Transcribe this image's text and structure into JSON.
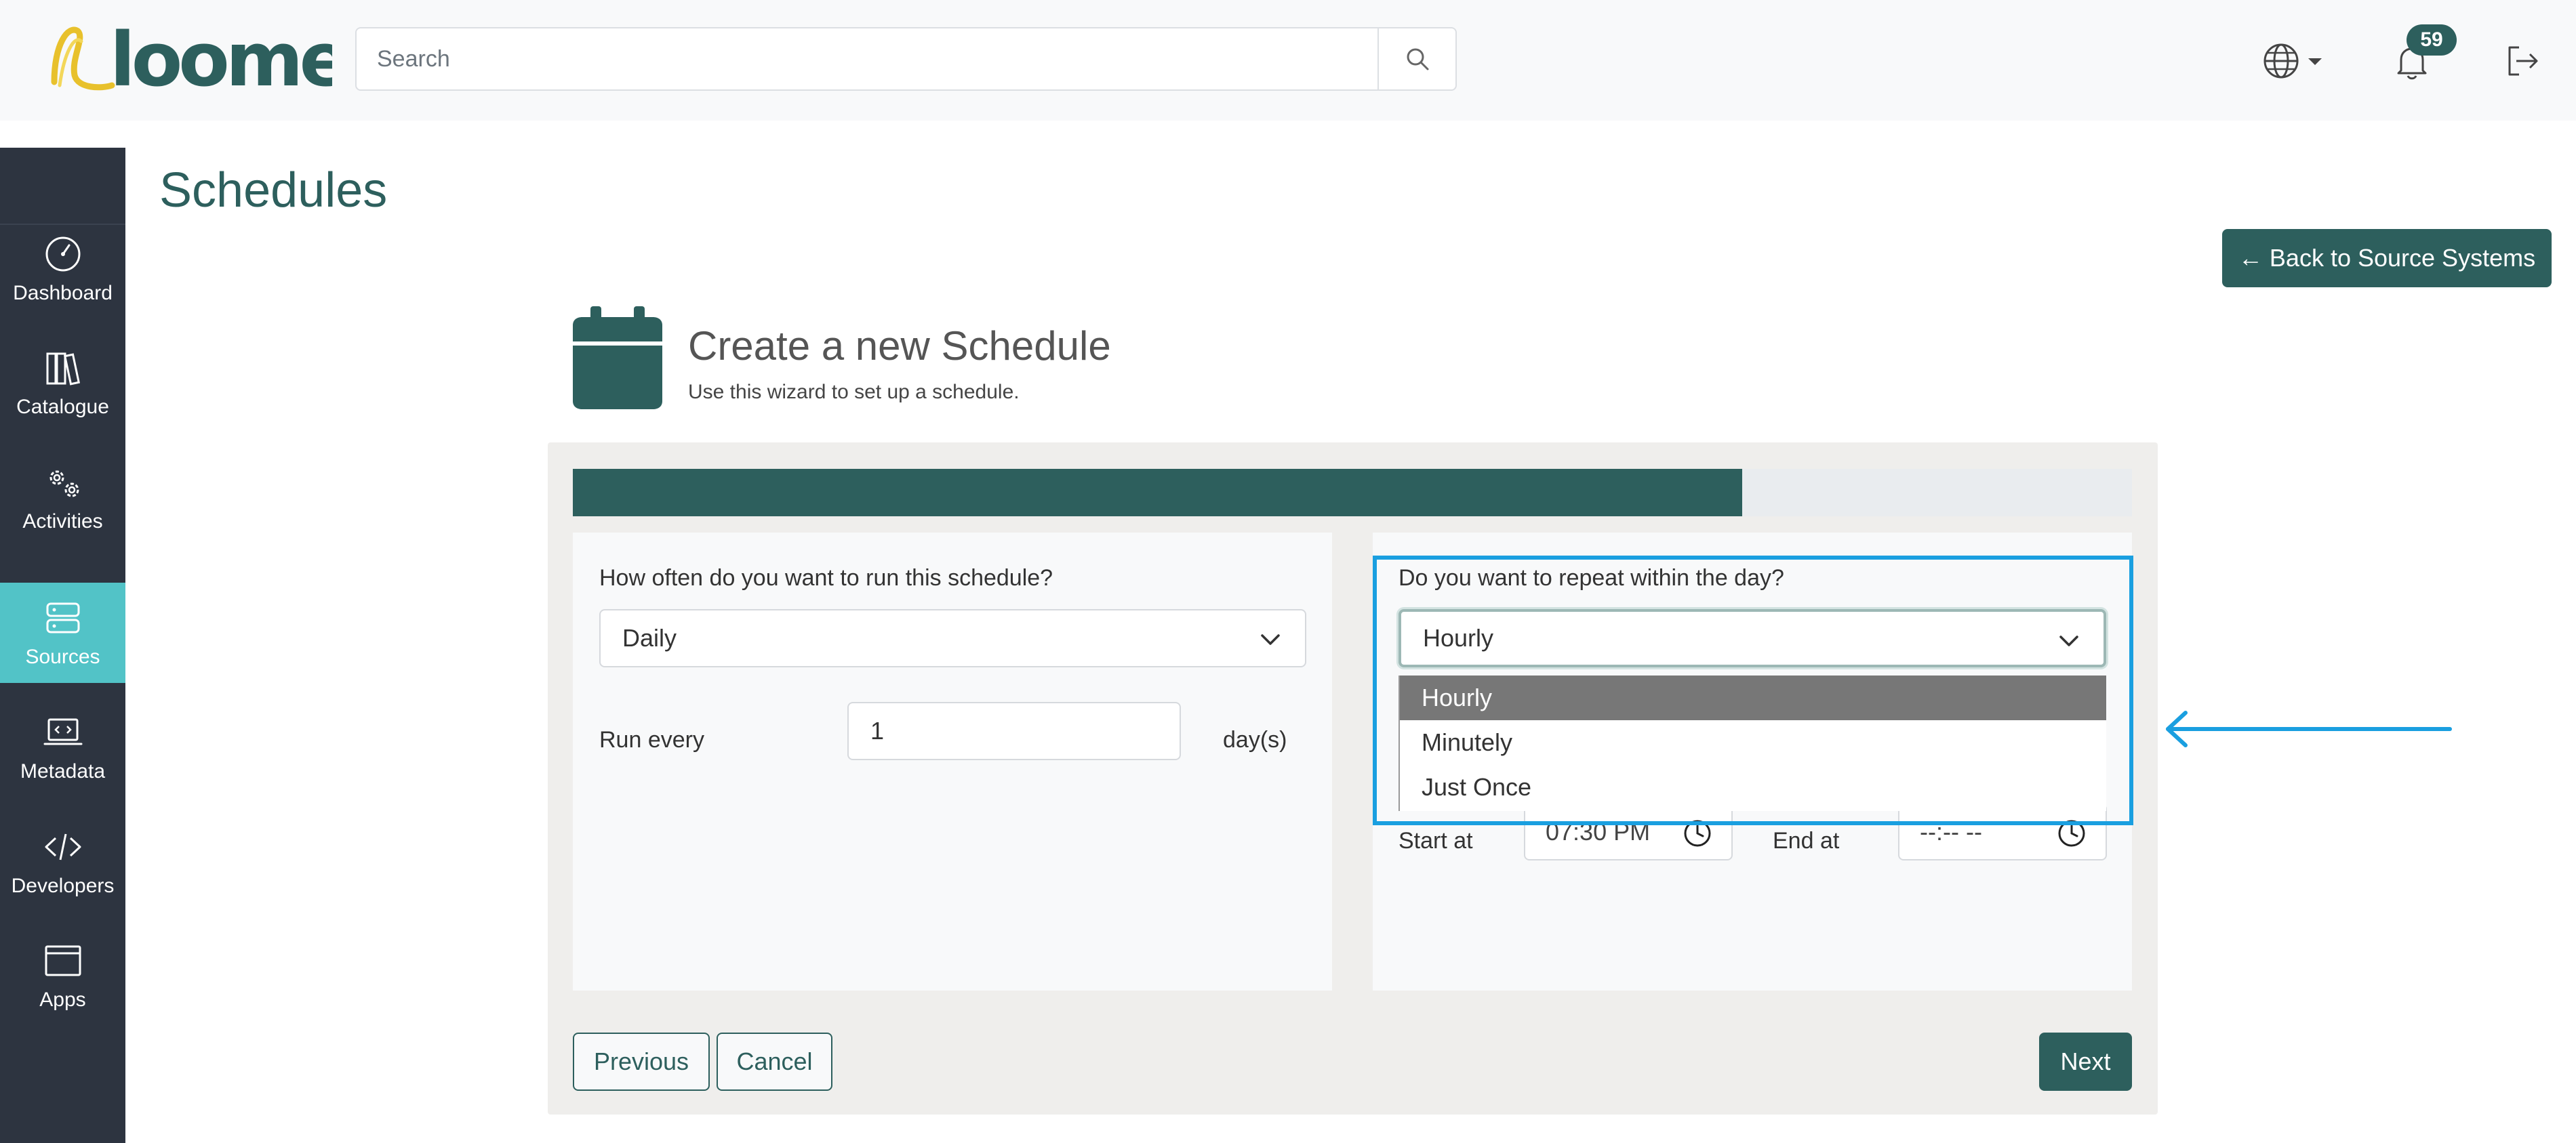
{
  "header": {
    "search_placeholder": "Search",
    "notification_count": "59",
    "brand_color": "#2d5f5d"
  },
  "sidebar": {
    "items": [
      {
        "label": "Dashboard",
        "icon": "gauge-icon"
      },
      {
        "label": "Catalogue",
        "icon": "books-icon"
      },
      {
        "label": "Activities",
        "icon": "gears-icon"
      },
      {
        "label": "Sources",
        "icon": "server-icon",
        "active": true
      },
      {
        "label": "Metadata",
        "icon": "laptop-code-icon"
      },
      {
        "label": "Developers",
        "icon": "code-icon"
      },
      {
        "label": "Apps",
        "icon": "window-icon"
      }
    ],
    "active_color": "#52c3c7"
  },
  "page": {
    "title": "Schedules",
    "back_button": "← Back to Source Systems"
  },
  "wizard": {
    "title": "Create a new Schedule",
    "subtitle": "Use this wizard to set up a schedule.",
    "progress": 0.75,
    "left": {
      "frequency_label": "How often do you want to run this schedule?",
      "frequency_value": "Daily",
      "run_every_label": "Run every",
      "run_every_value": "1",
      "run_every_unit": "day(s)"
    },
    "right": {
      "repeat_label": "Do you want to repeat within the day?",
      "repeat_value": "Hourly",
      "repeat_options": [
        "Hourly",
        "Minutely",
        "Just Once"
      ],
      "start_label": "Start at",
      "start_value": "07:30 PM",
      "end_label": "End at",
      "end_value": "--:-- --"
    },
    "buttons": {
      "previous": "Previous",
      "cancel": "Cancel",
      "next": "Next"
    }
  }
}
